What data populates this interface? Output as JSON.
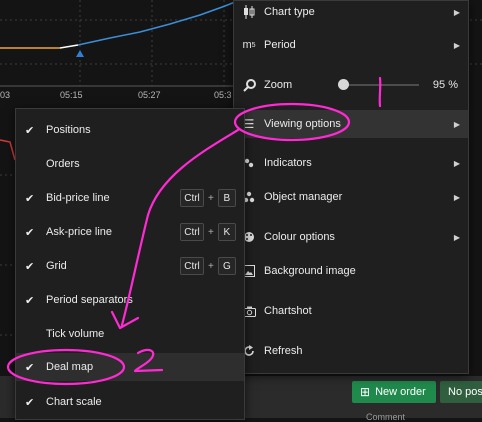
{
  "chart": {
    "time_labels": [
      "03",
      "05:15",
      "05:27",
      "05:3"
    ]
  },
  "main_menu": {
    "items": [
      {
        "label": "Chart type",
        "icon": "candlestick-icon",
        "has_submenu": true
      },
      {
        "label": "Period",
        "icon": "period-icon",
        "has_submenu": true
      },
      {
        "label": "Zoom",
        "icon": "zoom-icon",
        "value": "95 %",
        "slider_fraction": 0.1
      },
      {
        "label": "Viewing options",
        "icon": "list-icon",
        "has_submenu": true
      },
      {
        "label": "Indicators",
        "icon": "indicators-icon",
        "has_submenu": true
      },
      {
        "label": "Object manager",
        "icon": "objects-icon",
        "has_submenu": true
      },
      {
        "label": "Colour options",
        "icon": "palette-icon",
        "has_submenu": true
      },
      {
        "label": "Background image",
        "icon": "image-icon",
        "has_submenu": false
      },
      {
        "label": "Chartshot",
        "icon": "camera-icon",
        "has_submenu": false
      },
      {
        "label": "Refresh",
        "icon": "refresh-icon",
        "has_submenu": false
      }
    ],
    "period_icon_text": "m",
    "period_icon_sub": "5"
  },
  "viewing_options": {
    "items": [
      {
        "label": "Positions",
        "checked": true
      },
      {
        "label": "Orders",
        "checked": false
      },
      {
        "label": "Bid-price line",
        "checked": true,
        "key": "B"
      },
      {
        "label": "Ask-price line",
        "checked": true,
        "key": "K"
      },
      {
        "label": "Grid",
        "checked": true,
        "key": "G"
      },
      {
        "label": "Period separators",
        "checked": true
      },
      {
        "label": "Tick volume",
        "checked": false
      },
      {
        "label": "Deal map",
        "checked": true
      },
      {
        "label": "Chart scale",
        "checked": true
      }
    ],
    "ctrl_label": "Ctrl",
    "plus_label": "+",
    "check_glyph": "✔"
  },
  "bottom_bar": {
    "new_order_label": "New order",
    "no_positions_label": "No pos",
    "comment_label": "Comment"
  },
  "colors": {
    "annotation": "#ff2ad4",
    "new_order_bg": "#1f8a4c",
    "chart_line_blue": "#3b8fd9",
    "chart_line_orange": "#f0a53a",
    "chart_red": "#d83a3a"
  }
}
